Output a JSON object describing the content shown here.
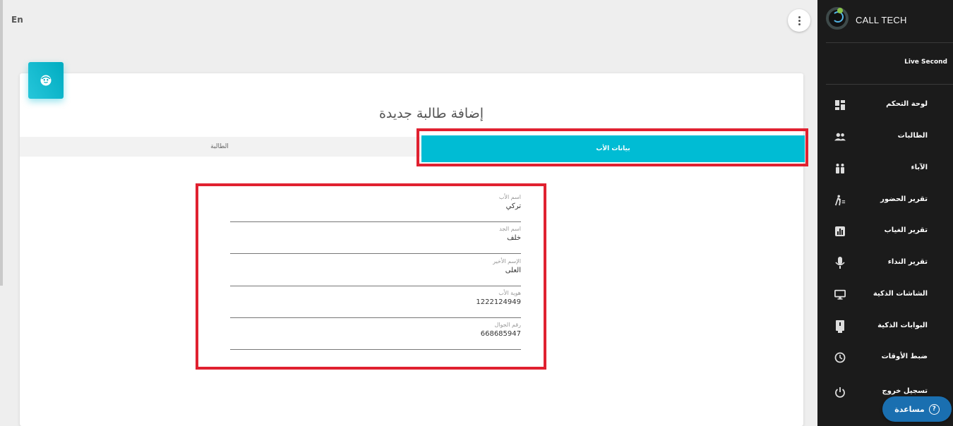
{
  "topbar": {
    "language_toggle": "En"
  },
  "page": {
    "title": "إضافة طالبة جديدة"
  },
  "tabs": [
    {
      "label": "الطالبة",
      "active": false
    },
    {
      "label": "بيانات الأب",
      "active": true
    }
  ],
  "father_form": {
    "fields": [
      {
        "label": "اسم الأب",
        "value": "تركي"
      },
      {
        "label": "اسم الجد",
        "value": "خلف"
      },
      {
        "label": "الإسم الأخير",
        "value": "العلى"
      },
      {
        "label": "هوية الأب",
        "value": "1222124949"
      },
      {
        "label": "رقم الجوال",
        "value": "668685947"
      }
    ]
  },
  "sidebar": {
    "brand": "CALL TECH",
    "live_second": "Live Second",
    "items": [
      {
        "label": "لوحة التحكم",
        "icon": "dashboard-icon"
      },
      {
        "label": "الطالبات",
        "icon": "people-icon"
      },
      {
        "label": "الآباء",
        "icon": "family-icon"
      },
      {
        "label": "تقرير الحضور",
        "icon": "walking-icon"
      },
      {
        "label": "تقرير الغياب",
        "icon": "chart-icon"
      },
      {
        "label": "تقرير النداء",
        "icon": "microphone-icon"
      },
      {
        "label": "الشاشات الذكية",
        "icon": "monitor-icon"
      },
      {
        "label": "البوابات الذكية",
        "icon": "gate-icon"
      },
      {
        "label": "ضبط الأوقات",
        "icon": "clock-icon"
      },
      {
        "label": "تسجيل خروج",
        "icon": "power-icon"
      }
    ]
  },
  "help_button": {
    "label": "مساعدة"
  },
  "colors": {
    "accent": "#00bcd4",
    "sidebar_bg": "#1b1b1b",
    "highlight": "#e02130",
    "help_bg": "#1a6fb0"
  }
}
